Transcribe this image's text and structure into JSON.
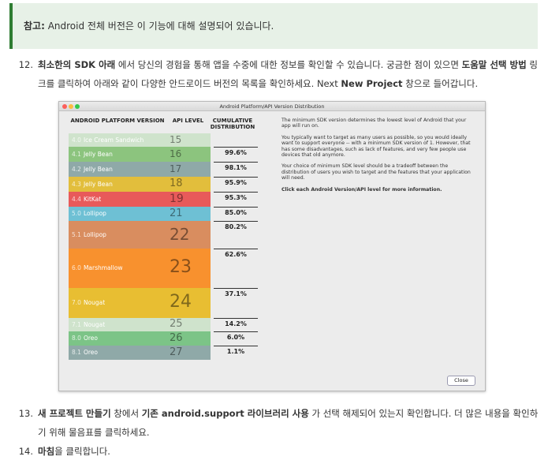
{
  "note": {
    "label": "참고:",
    "text": " Android 전체 버전은 이 기능에 대해 설명되어 있습니다."
  },
  "step12": {
    "number": "12.",
    "bold1": "최소한의 SDK 아래",
    "text1": " 에서 당신의 경험을 통해 앱을 수중에 대한 정보를 확인할 수 있습니다. 궁금한 점이 있으면 ",
    "bold2": "도움말 선택 방법",
    "text2": " 링크를 클릭하여 아래와 같이 다양한 안드로이드 버전의 목록을 확인하세요. Next ",
    "bold3": "New Project",
    "text3": " 창으로 들어갑니다."
  },
  "dialog": {
    "title": "Android Platform/API Version Distribution",
    "headers": {
      "platform": "ANDROID PLATFORM VERSION",
      "api": "API LEVEL",
      "cumulative": "CUMULATIVE DISTRIBUTION"
    },
    "versions": [
      {
        "num": "4.0",
        "name": "Ice Cream Sandwich",
        "api": "15",
        "cumulative": "",
        "color": "#cfe3cc"
      },
      {
        "num": "4.1",
        "name": "Jelly Bean",
        "api": "16",
        "cumulative": "99.6%",
        "color": "#8cc47e"
      },
      {
        "num": "4.2",
        "name": "Jelly Bean",
        "api": "17",
        "cumulative": "98.1%",
        "color": "#8fa9a8"
      },
      {
        "num": "4.3",
        "name": "Jelly Bean",
        "api": "18",
        "cumulative": "95.9%",
        "color": "#e2be3c"
      },
      {
        "num": "4.4",
        "name": "KitKat",
        "api": "19",
        "cumulative": "95.3%",
        "color": "#e85a5a"
      },
      {
        "num": "5.0",
        "name": "Lollipop",
        "api": "21",
        "cumulative": "85.0%",
        "color": "#6ec0d4"
      },
      {
        "num": "5.1",
        "name": "Lollipop",
        "api": "22",
        "cumulative": "80.2%",
        "color": "#d98d5f"
      },
      {
        "num": "6.0",
        "name": "Marshmallow",
        "api": "23",
        "cumulative": "62.6%",
        "color": "#f8912e"
      },
      {
        "num": "7.0",
        "name": "Nougat",
        "api": "24",
        "cumulative": "37.1%",
        "color": "#e8be32"
      },
      {
        "num": "7.1",
        "name": "Nougat",
        "api": "25",
        "cumulative": "14.2%",
        "color": "#cfe3cc"
      },
      {
        "num": "8.0",
        "name": "Oreo",
        "api": "26",
        "cumulative": "6.0%",
        "color": "#7cc487"
      },
      {
        "num": "8.1",
        "name": "Oreo",
        "api": "27",
        "cumulative": "1.1%",
        "color": "#8fa9a8"
      }
    ],
    "description": [
      "The minimum SDK version determines the lowest level of Android that your app will run on.",
      "You typically want to target as many users as possible, so you would ideally want to support everyone -- with a minimum SDK version of 1. However, that has some disadvantages, such as lack of features, and very few people use devices that old anymore.",
      "Your choice of minimum SDK level should be a tradeoff between the distribution of users you wish to target and the features that your application will need."
    ],
    "description_bold": "Click each Android Version/API level for more information.",
    "close_label": "Close"
  },
  "step13": {
    "number": "13.",
    "bold1": "새 프로젝트 만들기",
    "text1": " 창에서 ",
    "bold2": "기존 android.support 라이브러리 사용",
    "text2": " 가 선택 해제되어 있는지 확인합니다. 더 많은 내용을 확인하기 위해 물음표를 클릭하세요."
  },
  "step14": {
    "number": "14.",
    "bold1": "마침",
    "text1": "을 클릭합니다."
  }
}
